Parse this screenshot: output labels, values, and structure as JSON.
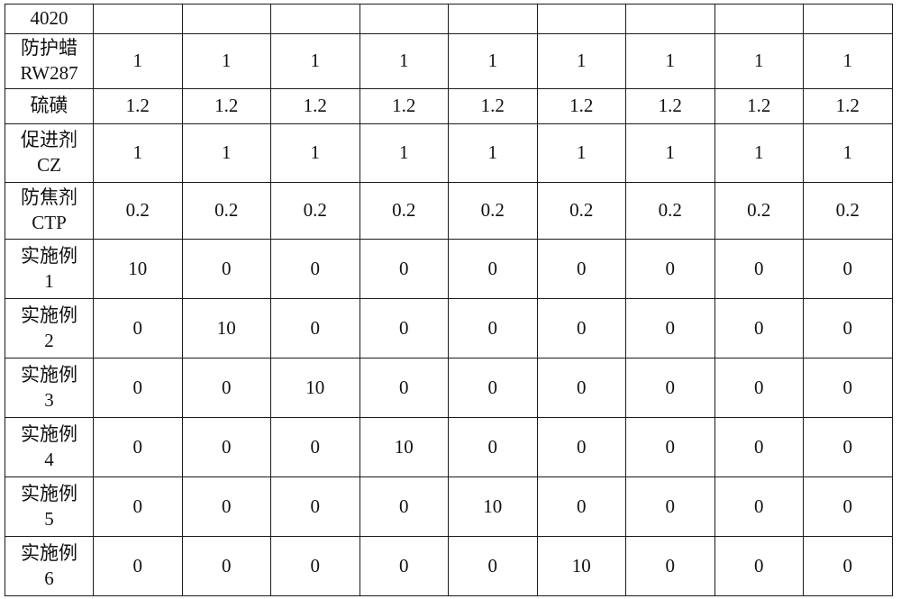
{
  "document": {
    "type": "patent-specification-table",
    "table": {
      "label_column_header": "",
      "column_count": 10,
      "data_column_count": 9,
      "row_count": 11,
      "rows": [
        {
          "name": "row-4020",
          "label_lines": [
            "4020"
          ],
          "values": [
            "",
            "",
            "",
            "",
            "",
            "",
            "",
            "",
            ""
          ]
        },
        {
          "name": "row-protective-wax",
          "label_lines": [
            "防护蜡",
            "RW287"
          ],
          "values": [
            "1",
            "1",
            "1",
            "1",
            "1",
            "1",
            "1",
            "1",
            "1"
          ]
        },
        {
          "name": "row-sulfur",
          "label_lines": [
            "硫磺"
          ],
          "values": [
            "1.2",
            "1.2",
            "1.2",
            "1.2",
            "1.2",
            "1.2",
            "1.2",
            "1.2",
            "1.2"
          ]
        },
        {
          "name": "row-accelerator-cz",
          "label_lines": [
            "促进剂",
            "CZ"
          ],
          "values": [
            "1",
            "1",
            "1",
            "1",
            "1",
            "1",
            "1",
            "1",
            "1"
          ]
        },
        {
          "name": "row-antiscorch-ctp",
          "label_lines": [
            "防焦剂",
            "CTP"
          ],
          "values": [
            "0.2",
            "0.2",
            "0.2",
            "0.2",
            "0.2",
            "0.2",
            "0.2",
            "0.2",
            "0.2"
          ]
        },
        {
          "name": "row-example-1",
          "label_lines": [
            "实施例",
            "1"
          ],
          "values": [
            "10",
            "0",
            "0",
            "0",
            "0",
            "0",
            "0",
            "0",
            "0"
          ]
        },
        {
          "name": "row-example-2",
          "label_lines": [
            "实施例",
            "2"
          ],
          "values": [
            "0",
            "10",
            "0",
            "0",
            "0",
            "0",
            "0",
            "0",
            "0"
          ]
        },
        {
          "name": "row-example-3",
          "label_lines": [
            "实施例",
            "3"
          ],
          "values": [
            "0",
            "0",
            "10",
            "0",
            "0",
            "0",
            "0",
            "0",
            "0"
          ]
        },
        {
          "name": "row-example-4",
          "label_lines": [
            "实施例",
            "4"
          ],
          "values": [
            "0",
            "0",
            "0",
            "10",
            "0",
            "0",
            "0",
            "0",
            "0"
          ]
        },
        {
          "name": "row-example-5",
          "label_lines": [
            "实施例",
            "5"
          ],
          "values": [
            "0",
            "0",
            "0",
            "0",
            "10",
            "0",
            "0",
            "0",
            "0"
          ]
        },
        {
          "name": "row-example-6",
          "label_lines": [
            "实施例",
            "6"
          ],
          "values": [
            "0",
            "0",
            "0",
            "0",
            "0",
            "10",
            "0",
            "0",
            "0"
          ]
        }
      ]
    }
  },
  "colors": {
    "border": "#1a1a1a",
    "text": "#111111",
    "background": "#ffffff"
  }
}
